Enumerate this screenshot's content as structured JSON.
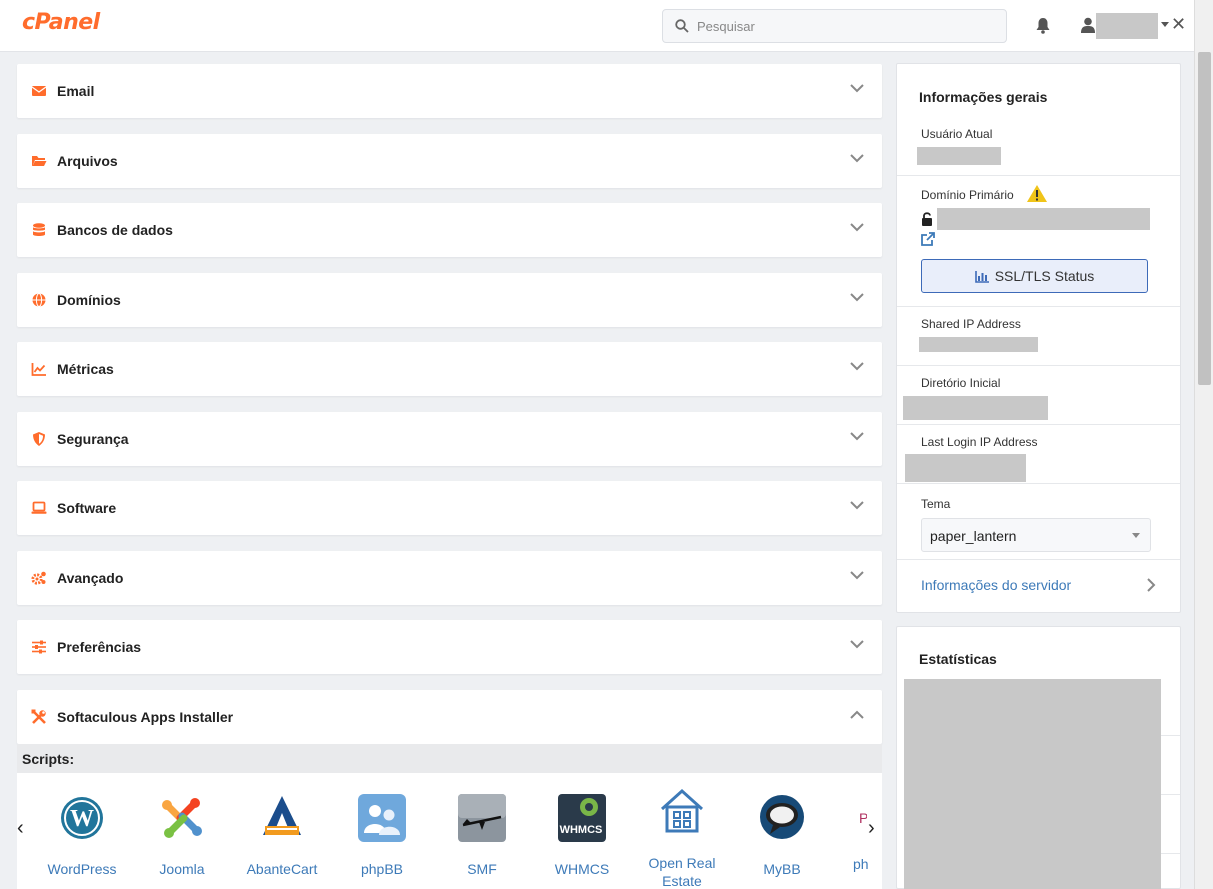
{
  "header": {
    "logo": "cPanel",
    "search_placeholder": "Pesquisar"
  },
  "sections": [
    {
      "title": "Email",
      "icon": "envelope-icon"
    },
    {
      "title": "Arquivos",
      "icon": "folder-icon"
    },
    {
      "title": "Bancos de dados",
      "icon": "database-icon"
    },
    {
      "title": "Domínios",
      "icon": "globe-icon"
    },
    {
      "title": "Métricas",
      "icon": "chart-icon"
    },
    {
      "title": "Segurança",
      "icon": "shield-icon"
    },
    {
      "title": "Software",
      "icon": "laptop-icon"
    },
    {
      "title": "Avançado",
      "icon": "gears-icon"
    },
    {
      "title": "Preferências",
      "icon": "sliders-icon"
    }
  ],
  "softaculous": {
    "title": "Softaculous Apps Installer",
    "scripts_label": "Scripts:",
    "apps": [
      {
        "label": "WordPress",
        "icon": "wordpress-icon"
      },
      {
        "label": "Joomla",
        "icon": "joomla-icon"
      },
      {
        "label": "AbanteCart",
        "icon": "abantecart-icon"
      },
      {
        "label": "phpBB",
        "icon": "phpbb-icon"
      },
      {
        "label": "SMF",
        "icon": "smf-icon"
      },
      {
        "label": "WHMCS",
        "icon": "whmcs-icon"
      },
      {
        "label": "Open Real Estate",
        "icon": "open-real-estate-icon"
      },
      {
        "label": "MyBB",
        "icon": "mybb-icon"
      },
      {
        "label": "ph",
        "icon": "partial-app-icon"
      }
    ]
  },
  "info": {
    "title": "Informações gerais",
    "current_user_label": "Usuário Atual",
    "primary_domain_label": "Domínio Primário",
    "ssl_button": "SSL/TLS Status",
    "shared_ip_label": "Shared IP Address",
    "home_dir_label": "Diretório Inicial",
    "last_login_label": "Last Login IP Address",
    "theme_label": "Tema",
    "theme_value": "paper_lantern",
    "server_info_link": "Informações do servidor"
  },
  "stats": {
    "title": "Estatísticas"
  },
  "colors": {
    "brand": "#ff6c2c",
    "link": "#3d7ab8",
    "warning": "#f0c419"
  }
}
